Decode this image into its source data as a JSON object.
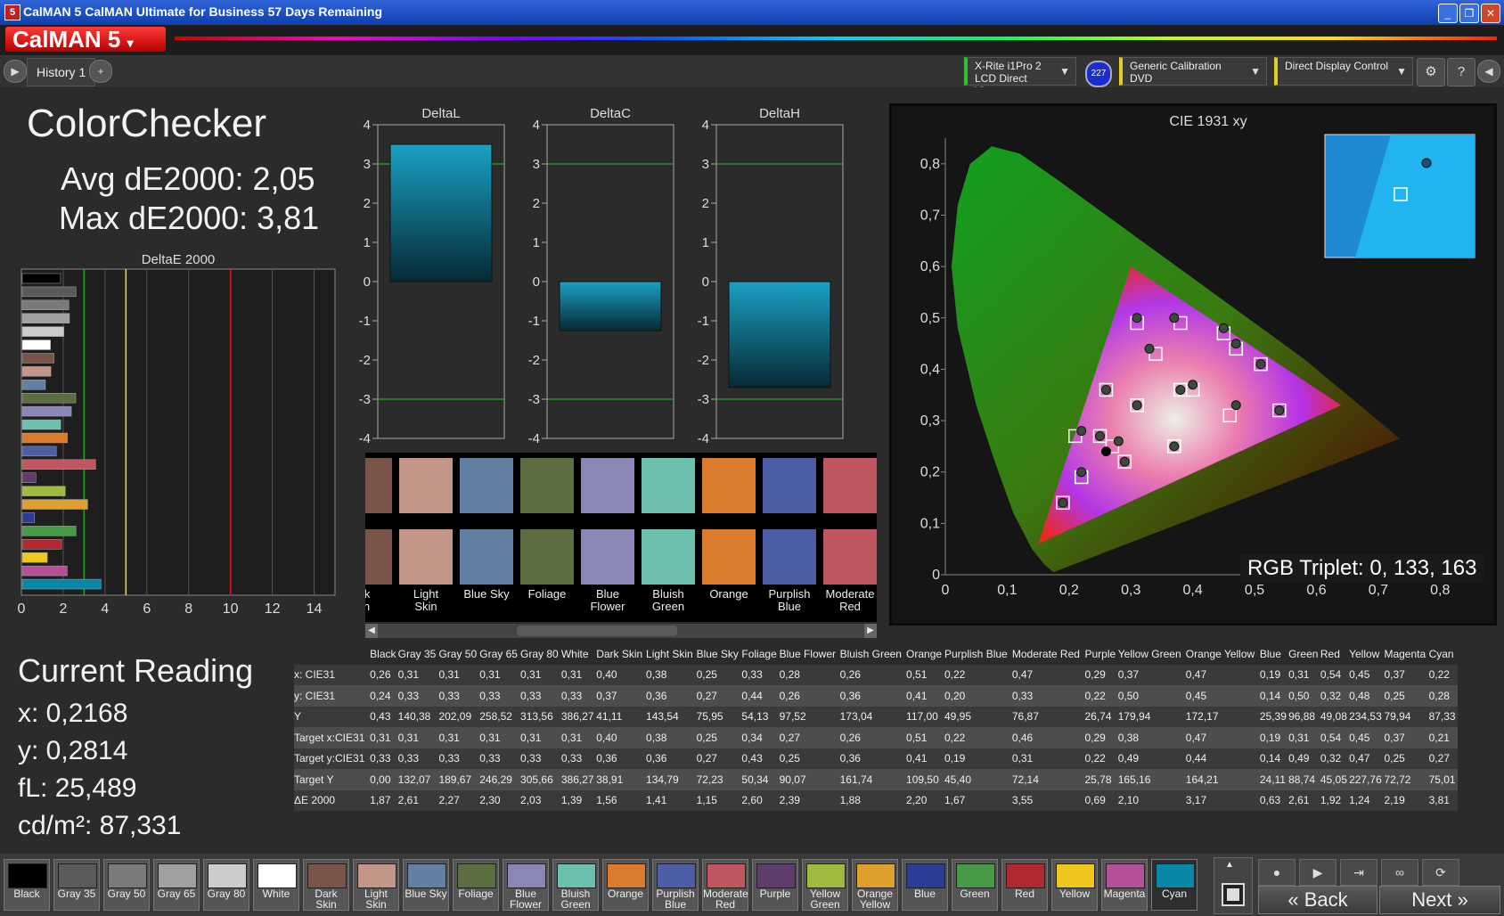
{
  "window": {
    "title": "CalMAN 5 CalMAN Ultimate for Business 57 Days Remaining",
    "app_icon": "5"
  },
  "logo": {
    "text": "CalMAN 5"
  },
  "toolbar": {
    "tab": "History 1",
    "meter": {
      "line1": "X-Rite i1Pro 2",
      "line2": "LCD Direct View",
      "badge": "227"
    },
    "source": "Generic Calibration DVD",
    "display": "Direct Display Control"
  },
  "summary": {
    "title": "ColorChecker",
    "avg": "Avg dE2000: 2,05",
    "max": "Max dE2000: 3,81"
  },
  "current": {
    "title": "Current Reading",
    "x": "x: 0,2168",
    "y": "y: 0,2814",
    "fl": "fL: 25,489",
    "cdm": "cd/m²: 87,331"
  },
  "cie": {
    "title": "CIE 1931 xy",
    "triplet": "RGB Triplet: 0, 133, 163"
  },
  "swatch_labels": [
    "rk\nin",
    "Light\nSkin",
    "Blue Sky",
    "Foliage",
    "Blue\nFlower",
    "Bluish\nGreen",
    "Orange",
    "Purplish\nBlue",
    "Moderate\nRed"
  ],
  "swatch_colors": [
    "#7a5448",
    "#c4968a",
    "#6280a4",
    "#5a6e42",
    "#8a86b6",
    "#6cc0b0",
    "#da7c2c",
    "#4e5ea6",
    "#c05660"
  ],
  "table": {
    "headers": [
      "",
      "Black",
      "Gray 35",
      "Gray 50",
      "Gray 65",
      "Gray 80",
      "White",
      "Dark Skin",
      "Light Skin",
      "Blue Sky",
      "Foliage",
      "Blue Flower",
      "Bluish Green",
      "Orange",
      "Purplish Blue",
      "Moderate Red",
      "Purple",
      "Yellow Green",
      "Orange Yellow",
      "Blue",
      "Green",
      "Red",
      "Yellow",
      "Magenta",
      "Cyan"
    ],
    "rows": [
      [
        "x: CIE31",
        "0,26",
        "0,31",
        "0,31",
        "0,31",
        "0,31",
        "0,31",
        "0,40",
        "0,38",
        "0,25",
        "0,33",
        "0,28",
        "0,26",
        "0,51",
        "0,22",
        "0,47",
        "0,29",
        "0,37",
        "0,47",
        "0,19",
        "0,31",
        "0,54",
        "0,45",
        "0,37",
        "0,22"
      ],
      [
        "y: CIE31",
        "0,24",
        "0,33",
        "0,33",
        "0,33",
        "0,33",
        "0,33",
        "0,37",
        "0,36",
        "0,27",
        "0,44",
        "0,26",
        "0,36",
        "0,41",
        "0,20",
        "0,33",
        "0,22",
        "0,50",
        "0,45",
        "0,14",
        "0,50",
        "0,32",
        "0,48",
        "0,25",
        "0,28"
      ],
      [
        "Y",
        "0,43",
        "140,38",
        "202,09",
        "258,52",
        "313,56",
        "386,27",
        "41,11",
        "143,54",
        "75,95",
        "54,13",
        "97,52",
        "173,04",
        "117,00",
        "49,95",
        "76,87",
        "26,74",
        "179,94",
        "172,17",
        "25,39",
        "96,88",
        "49,08",
        "234,53",
        "79,94",
        "87,33"
      ],
      [
        "Target x:CIE31",
        "0,31",
        "0,31",
        "0,31",
        "0,31",
        "0,31",
        "0,31",
        "0,40",
        "0,38",
        "0,25",
        "0,34",
        "0,27",
        "0,26",
        "0,51",
        "0,22",
        "0,46",
        "0,29",
        "0,38",
        "0,47",
        "0,19",
        "0,31",
        "0,54",
        "0,45",
        "0,37",
        "0,21"
      ],
      [
        "Target y:CIE31",
        "0,33",
        "0,33",
        "0,33",
        "0,33",
        "0,33",
        "0,33",
        "0,36",
        "0,36",
        "0,27",
        "0,43",
        "0,25",
        "0,36",
        "0,41",
        "0,19",
        "0,31",
        "0,22",
        "0,49",
        "0,44",
        "0,14",
        "0,49",
        "0,32",
        "0,47",
        "0,25",
        "0,27"
      ],
      [
        "Target Y",
        "0,00",
        "132,07",
        "189,67",
        "246,29",
        "305,66",
        "386,27",
        "38,91",
        "134,79",
        "72,23",
        "50,34",
        "90,07",
        "161,74",
        "109,50",
        "45,40",
        "72,14",
        "25,78",
        "165,16",
        "164,21",
        "24,11",
        "88,74",
        "45,05",
        "227,76",
        "72,72",
        "75,01"
      ],
      [
        "ΔE 2000",
        "1,87",
        "2,61",
        "2,27",
        "2,30",
        "2,03",
        "1,39",
        "1,56",
        "1,41",
        "1,15",
        "2,60",
        "2,39",
        "1,88",
        "2,20",
        "1,67",
        "3,55",
        "0,69",
        "2,10",
        "3,17",
        "0,63",
        "2,61",
        "1,92",
        "1,24",
        "2,19",
        "3,81"
      ]
    ]
  },
  "bottom_swatches": [
    {
      "label": "Black",
      "color": "#000000"
    },
    {
      "label": "Gray 35",
      "color": "#5a5a5a"
    },
    {
      "label": "Gray 50",
      "color": "#7a7a7a"
    },
    {
      "label": "Gray 65",
      "color": "#a0a0a0"
    },
    {
      "label": "Gray 80",
      "color": "#cccccc"
    },
    {
      "label": "White",
      "color": "#ffffff"
    },
    {
      "label": "Dark\nSkin",
      "color": "#7a5448"
    },
    {
      "label": "Light\nSkin",
      "color": "#c4968a"
    },
    {
      "label": "Blue Sky",
      "color": "#6280a4"
    },
    {
      "label": "Foliage",
      "color": "#5a6e42"
    },
    {
      "label": "Blue\nFlower",
      "color": "#8a86b6"
    },
    {
      "label": "Bluish\nGreen",
      "color": "#6cc0b0"
    },
    {
      "label": "Orange",
      "color": "#da7c2c"
    },
    {
      "label": "Purplish\nBlue",
      "color": "#4e5ea6"
    },
    {
      "label": "Moderate\nRed",
      "color": "#c05660"
    },
    {
      "label": "Purple",
      "color": "#5e3c6c"
    },
    {
      "label": "Yellow\nGreen",
      "color": "#a0bc40"
    },
    {
      "label": "Orange\nYellow",
      "color": "#e0a030"
    },
    {
      "label": "Blue",
      "color": "#2c3c94"
    },
    {
      "label": "Green",
      "color": "#489a48"
    },
    {
      "label": "Red",
      "color": "#b02830"
    },
    {
      "label": "Yellow",
      "color": "#eec81e"
    },
    {
      "label": "Magenta",
      "color": "#b4509a"
    },
    {
      "label": "Cyan",
      "color": "#0888a6"
    }
  ],
  "nav": {
    "back": "Back",
    "next": "Next"
  },
  "chart_data": [
    {
      "type": "bar",
      "orientation": "horizontal",
      "title": "DeltaE 2000",
      "categories": [
        "Black",
        "Gray 35",
        "Gray 50",
        "Gray 65",
        "Gray 80",
        "White",
        "Dark Skin",
        "Light Skin",
        "Blue Sky",
        "Foliage",
        "Blue Flower",
        "Bluish Green",
        "Orange",
        "Purplish Blue",
        "Moderate Red",
        "Purple",
        "Yellow Green",
        "Orange Yellow",
        "Blue",
        "Green",
        "Red",
        "Yellow",
        "Magenta",
        "Cyan"
      ],
      "values": [
        1.87,
        2.61,
        2.27,
        2.3,
        2.03,
        1.39,
        1.56,
        1.41,
        1.15,
        2.6,
        2.39,
        1.88,
        2.2,
        1.67,
        3.55,
        0.69,
        2.1,
        3.17,
        0.63,
        2.61,
        1.92,
        1.24,
        2.19,
        3.81
      ],
      "colors": [
        "#000000",
        "#5a5a5a",
        "#7a7a7a",
        "#a0a0a0",
        "#cccccc",
        "#ffffff",
        "#7a5448",
        "#c4968a",
        "#6280a4",
        "#5a6e42",
        "#8a86b6",
        "#6cc0b0",
        "#da7c2c",
        "#4e5ea6",
        "#c05660",
        "#5e3c6c",
        "#a0bc40",
        "#e0a030",
        "#2c3c94",
        "#489a48",
        "#b02830",
        "#eec81e",
        "#b4509a",
        "#0888a6"
      ],
      "xlim": [
        0,
        15
      ],
      "xticks": [
        "0",
        "2",
        "4",
        "6",
        "8",
        "10",
        "12",
        "14"
      ],
      "thresholds": [
        {
          "value": 3,
          "color": "#30a030"
        },
        {
          "value": 5,
          "color": "#f0e020"
        },
        {
          "value": 10,
          "color": "#d02020"
        }
      ]
    },
    {
      "type": "bar",
      "title": "DeltaL",
      "values": [
        3.5
      ],
      "ylim": [
        -4,
        4
      ],
      "yticks": [
        "4",
        "3",
        "2",
        "1",
        "0",
        "-1",
        "-2",
        "-3",
        "-4"
      ],
      "guides": [
        3,
        -3
      ]
    },
    {
      "type": "bar",
      "title": "DeltaC",
      "values": [
        -1.25
      ],
      "ylim": [
        -4,
        4
      ],
      "yticks": [
        "4",
        "3",
        "2",
        "1",
        "0",
        "-1",
        "-2",
        "-3",
        "-4"
      ],
      "guides": [
        3,
        -3
      ]
    },
    {
      "type": "bar",
      "title": "DeltaH",
      "values": [
        -2.7
      ],
      "ylim": [
        -4,
        4
      ],
      "yticks": [
        "4",
        "3",
        "2",
        "1",
        "0",
        "-1",
        "-2",
        "-3",
        "-4"
      ],
      "guides": [
        3,
        -3
      ]
    },
    {
      "type": "scatter",
      "title": "CIE 1931 xy",
      "xlim": [
        0,
        0.85
      ],
      "ylim": [
        0,
        0.85
      ],
      "xticks": [
        "0",
        "0,1",
        "0,2",
        "0,3",
        "0,4",
        "0,5",
        "0,6",
        "0,7",
        "0,8"
      ],
      "yticks": [
        "0",
        "0,1",
        "0,2",
        "0,3",
        "0,4",
        "0,5",
        "0,6",
        "0,7",
        "0,8"
      ],
      "gamut": [
        [
          0.64,
          0.33
        ],
        [
          0.3,
          0.6
        ],
        [
          0.15,
          0.06
        ]
      ],
      "series": [
        {
          "name": "Measured",
          "points": [
            [
              0.26,
              0.24
            ],
            [
              0.31,
              0.33
            ],
            [
              0.4,
              0.37
            ],
            [
              0.38,
              0.36
            ],
            [
              0.25,
              0.27
            ],
            [
              0.33,
              0.44
            ],
            [
              0.28,
              0.26
            ],
            [
              0.26,
              0.36
            ],
            [
              0.51,
              0.41
            ],
            [
              0.22,
              0.2
            ],
            [
              0.47,
              0.33
            ],
            [
              0.29,
              0.22
            ],
            [
              0.37,
              0.5
            ],
            [
              0.47,
              0.45
            ],
            [
              0.19,
              0.14
            ],
            [
              0.31,
              0.5
            ],
            [
              0.54,
              0.32
            ],
            [
              0.45,
              0.48
            ],
            [
              0.37,
              0.25
            ],
            [
              0.22,
              0.28
            ]
          ]
        },
        {
          "name": "Target",
          "points": [
            [
              0.31,
              0.33
            ],
            [
              0.4,
              0.36
            ],
            [
              0.38,
              0.36
            ],
            [
              0.25,
              0.27
            ],
            [
              0.34,
              0.43
            ],
            [
              0.27,
              0.25
            ],
            [
              0.26,
              0.36
            ],
            [
              0.51,
              0.41
            ],
            [
              0.22,
              0.19
            ],
            [
              0.46,
              0.31
            ],
            [
              0.29,
              0.22
            ],
            [
              0.38,
              0.49
            ],
            [
              0.47,
              0.44
            ],
            [
              0.19,
              0.14
            ],
            [
              0.31,
              0.49
            ],
            [
              0.54,
              0.32
            ],
            [
              0.45,
              0.47
            ],
            [
              0.37,
              0.25
            ],
            [
              0.21,
              0.27
            ]
          ]
        }
      ]
    }
  ]
}
